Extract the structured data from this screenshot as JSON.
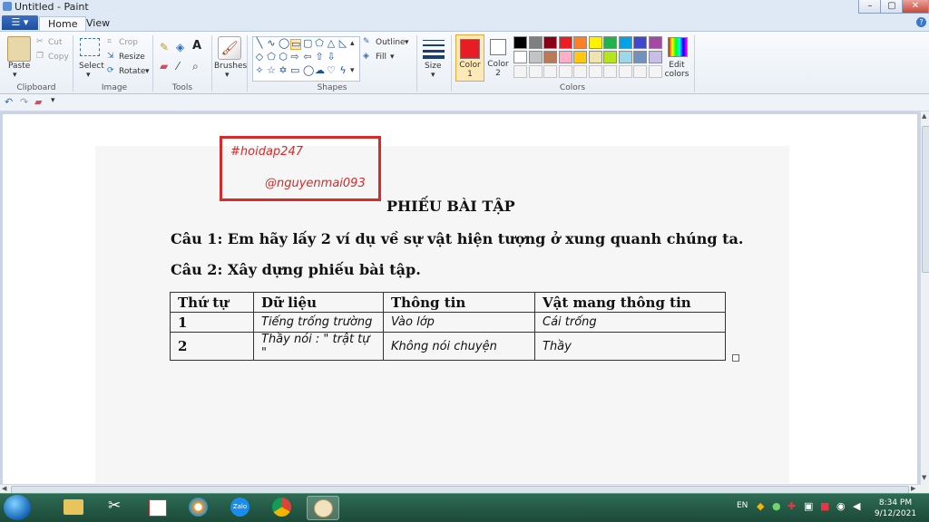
{
  "window": {
    "title": "Untitled - Paint"
  },
  "tabs": [
    {
      "label": "Home"
    },
    {
      "label": "View"
    }
  ],
  "clipboard": {
    "paste": "Paste",
    "cut": "Cut",
    "copy": "Copy",
    "group": "Clipboard"
  },
  "image": {
    "select": "Select",
    "crop": "Crop",
    "resize": "Resize",
    "rotate": "Rotate",
    "group": "Image"
  },
  "tools": {
    "group": "Tools"
  },
  "brushes": {
    "label": "Brushes"
  },
  "shapes": {
    "outline": "Outline",
    "fill": "Fill",
    "group": "Shapes"
  },
  "size": {
    "label": "Size"
  },
  "colors": {
    "color1": "Color 1",
    "color2": "Color 2",
    "edit": "Edit colors",
    "group": "Colors",
    "color1_value": "#e81c24",
    "color2_value": "#ffffff",
    "row1": [
      "#000000",
      "#7f7f7f",
      "#880015",
      "#ed1c24",
      "#ff7f27",
      "#fff200",
      "#22b14c",
      "#00a2e8",
      "#3f48cc",
      "#a349a4"
    ],
    "row2": [
      "#ffffff",
      "#c3c3c3",
      "#b97a57",
      "#ffaec9",
      "#ffc90e",
      "#efe4b0",
      "#b5e61d",
      "#99d9ea",
      "#7092be",
      "#c8bfe7"
    ]
  },
  "document": {
    "watermark1": "#hoidap247",
    "watermark2": "@nguyenmai093",
    "title": "PHIẾU BÀI TẬP",
    "q1": "Câu 1: Em hãy lấy 2 ví dụ về sự vật hiện tượng ở xung quanh chúng ta.",
    "q2": "Câu 2: Xây dựng phiếu bài tập.",
    "table": {
      "headers": [
        "Thứ tự",
        "Dữ liệu",
        "Thông tin",
        "Vật mang thông tin"
      ],
      "rows": [
        [
          "1",
          "Tiếng trống trường",
          "Vào lớp",
          "Cái trống"
        ],
        [
          "2",
          "Thầy nói : \" trật tự \"",
          "Không nói chuyện",
          " Thầy"
        ]
      ]
    }
  },
  "taskbar": {
    "lang": "EN",
    "time": "8:34 PM",
    "date": "9/12/2021"
  }
}
